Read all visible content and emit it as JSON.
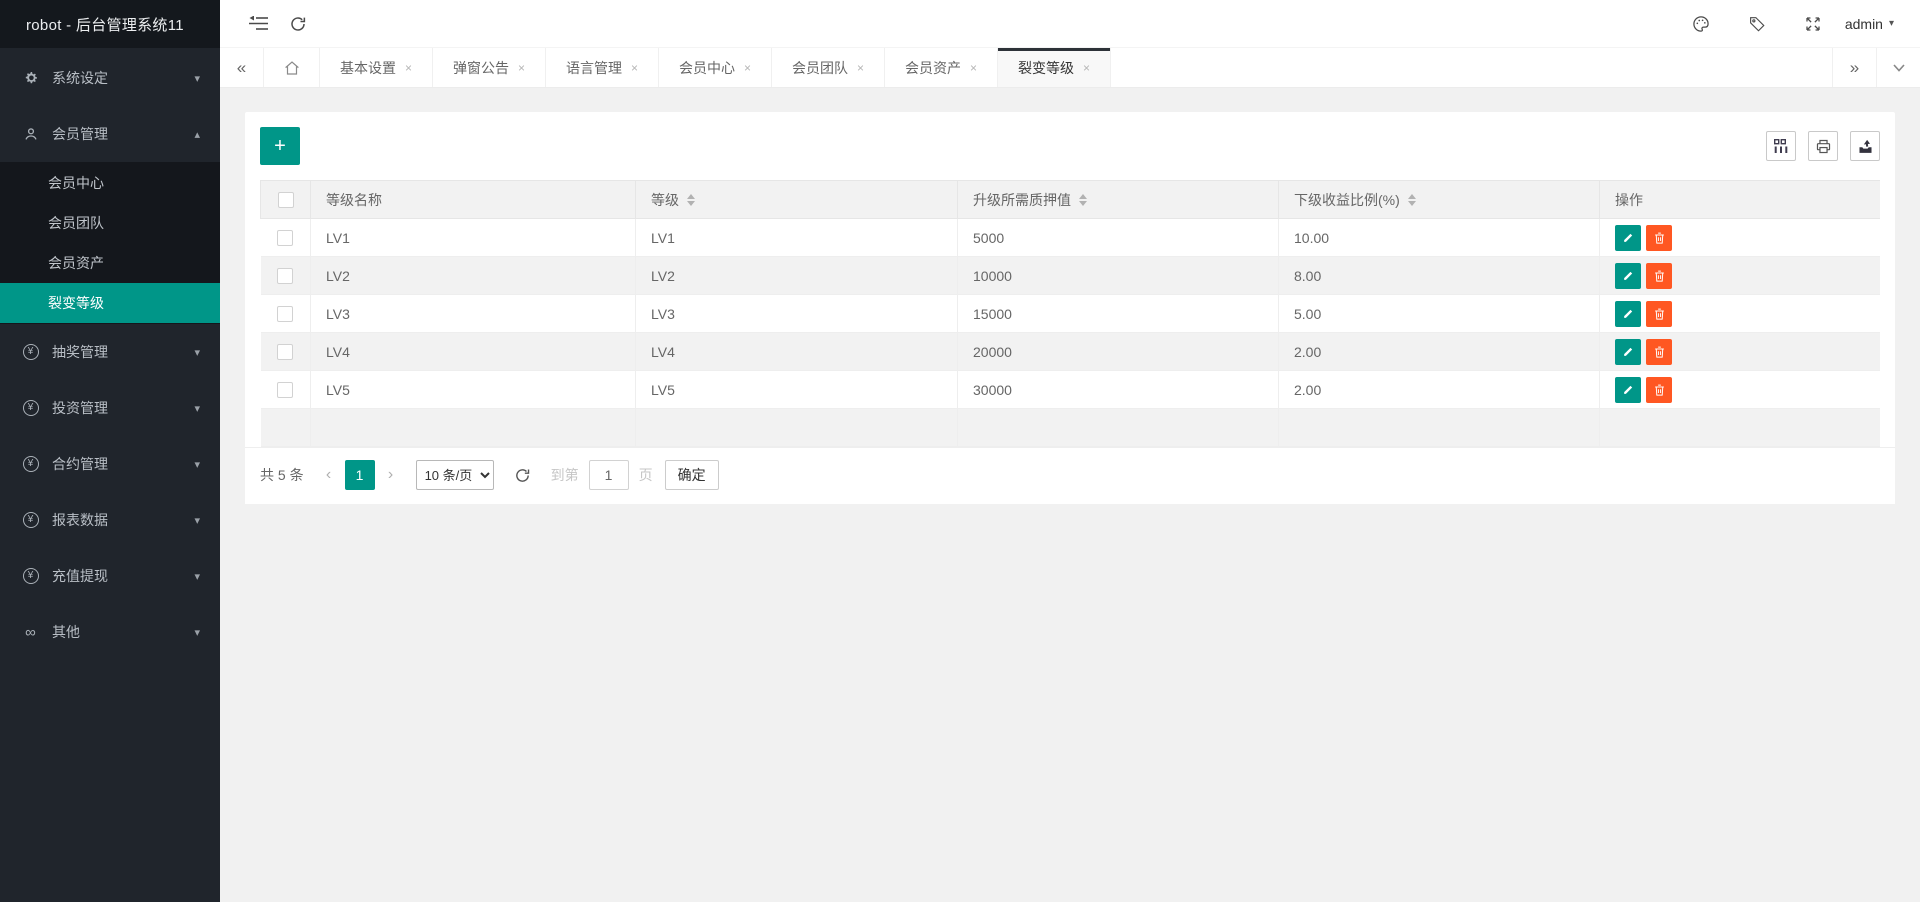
{
  "app": {
    "logo_title": "robot - 后台管理系统11",
    "user": "admin"
  },
  "colors": {
    "teal": "#009688",
    "orange": "#ff5722",
    "sidebar": "#20252c",
    "content_bg": "#f1f1f1"
  },
  "glyphs": {
    "plus": "+",
    "yuan": "¥",
    "link": "∞",
    "caret_down": "▾",
    "caret_up": "▴",
    "prev": "‹",
    "next": "›",
    "scroll_left": "«",
    "scroll_right": "»",
    "close": "×"
  },
  "sidebar": {
    "items": [
      {
        "label": "系统设定",
        "icon": "gear-icon"
      },
      {
        "label": "会员管理",
        "icon": "user-icon"
      },
      {
        "label": "抽奖管理",
        "icon": "yuan-icon"
      },
      {
        "label": "投资管理",
        "icon": "yuan-icon"
      },
      {
        "label": "合约管理",
        "icon": "yuan-icon"
      },
      {
        "label": "报表数据",
        "icon": "yuan-icon"
      },
      {
        "label": "充值提现",
        "icon": "yuan-icon"
      },
      {
        "label": "其他",
        "icon": "link-icon"
      }
    ],
    "member_children": [
      {
        "label": "会员中心"
      },
      {
        "label": "会员团队"
      },
      {
        "label": "会员资产"
      },
      {
        "label": "裂变等级",
        "active": true
      }
    ]
  },
  "tabs": {
    "items": [
      {
        "label": "基本设置"
      },
      {
        "label": "弹窗公告"
      },
      {
        "label": "语言管理"
      },
      {
        "label": "会员中心"
      },
      {
        "label": "会员团队"
      },
      {
        "label": "会员资产"
      },
      {
        "label": "裂变等级",
        "active": true
      }
    ]
  },
  "table": {
    "headers": {
      "name": "等级名称",
      "level": "等级",
      "pledge": "升级所需质押值",
      "ratio": "下级收益比例(%)",
      "ops": "操作"
    },
    "rows": [
      {
        "name": "LV1",
        "level": "LV1",
        "pledge": "5000",
        "ratio": "10.00"
      },
      {
        "name": "LV2",
        "level": "LV2",
        "pledge": "10000",
        "ratio": "8.00"
      },
      {
        "name": "LV3",
        "level": "LV3",
        "pledge": "15000",
        "ratio": "5.00"
      },
      {
        "name": "LV4",
        "level": "LV4",
        "pledge": "20000",
        "ratio": "2.00"
      },
      {
        "name": "LV5",
        "level": "LV5",
        "pledge": "30000",
        "ratio": "2.00"
      }
    ]
  },
  "pagination": {
    "total": "共 5 条",
    "current_page": "1",
    "page_size": "10 条/页",
    "goto_label": "到第",
    "goto_value": "1",
    "page_unit": "页",
    "confirm": "确定"
  }
}
